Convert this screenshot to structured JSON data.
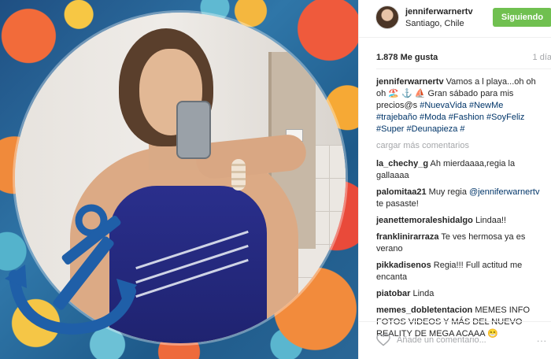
{
  "post": {
    "photo_icon": "anchor-icon",
    "accent_color": "#70c050",
    "link_color": "#003569",
    "muted_color": "#a5a7aa"
  },
  "header": {
    "username": "jenniferwarnertv",
    "location": "Santiago, Chile",
    "follow_label": "Siguiendo"
  },
  "stats": {
    "likes": "1.878 Me gusta",
    "date": "1 día"
  },
  "caption": {
    "user": "jenniferwarnertv",
    "text": "Vamos a l playa...oh oh oh 🏖️ ⚓️ ⛵ Gran sábado para mis precios@s",
    "hashtags": "#NuevaVida #NewMe #trajebaño #Moda #Fashion #SoyFeliz #Super #Deunapieza #"
  },
  "load_more": "cargar más comentarios",
  "comments": [
    {
      "user": "la_chechy_g",
      "text": "Ah mierdaaaa,regia la gallaaaa"
    },
    {
      "user": "palomitaa21",
      "text": "Muy regia",
      "mention": "@jenniferwarnertv",
      "after": " te pasaste!"
    },
    {
      "user": "jeanettemoraleshidalgo",
      "text": "Lindaa!!"
    },
    {
      "user": "franklinirarraza",
      "text": "Te ves hermosa ya es verano"
    },
    {
      "user": "pikkadisenos",
      "text": "Regia!!! Full actitud me encanta"
    },
    {
      "user": "piatobar",
      "text": "Linda"
    },
    {
      "user": "memes_dobletentacion",
      "text": "MEMES INFO FOTOS VIDEOS Y MÁS DEL NUEVO REALITY DE MEGA ACAAA 😁"
    }
  ],
  "composer": {
    "placeholder": "Añade un comentario...",
    "more_icon": "more-options-icon",
    "more_label": "..."
  }
}
